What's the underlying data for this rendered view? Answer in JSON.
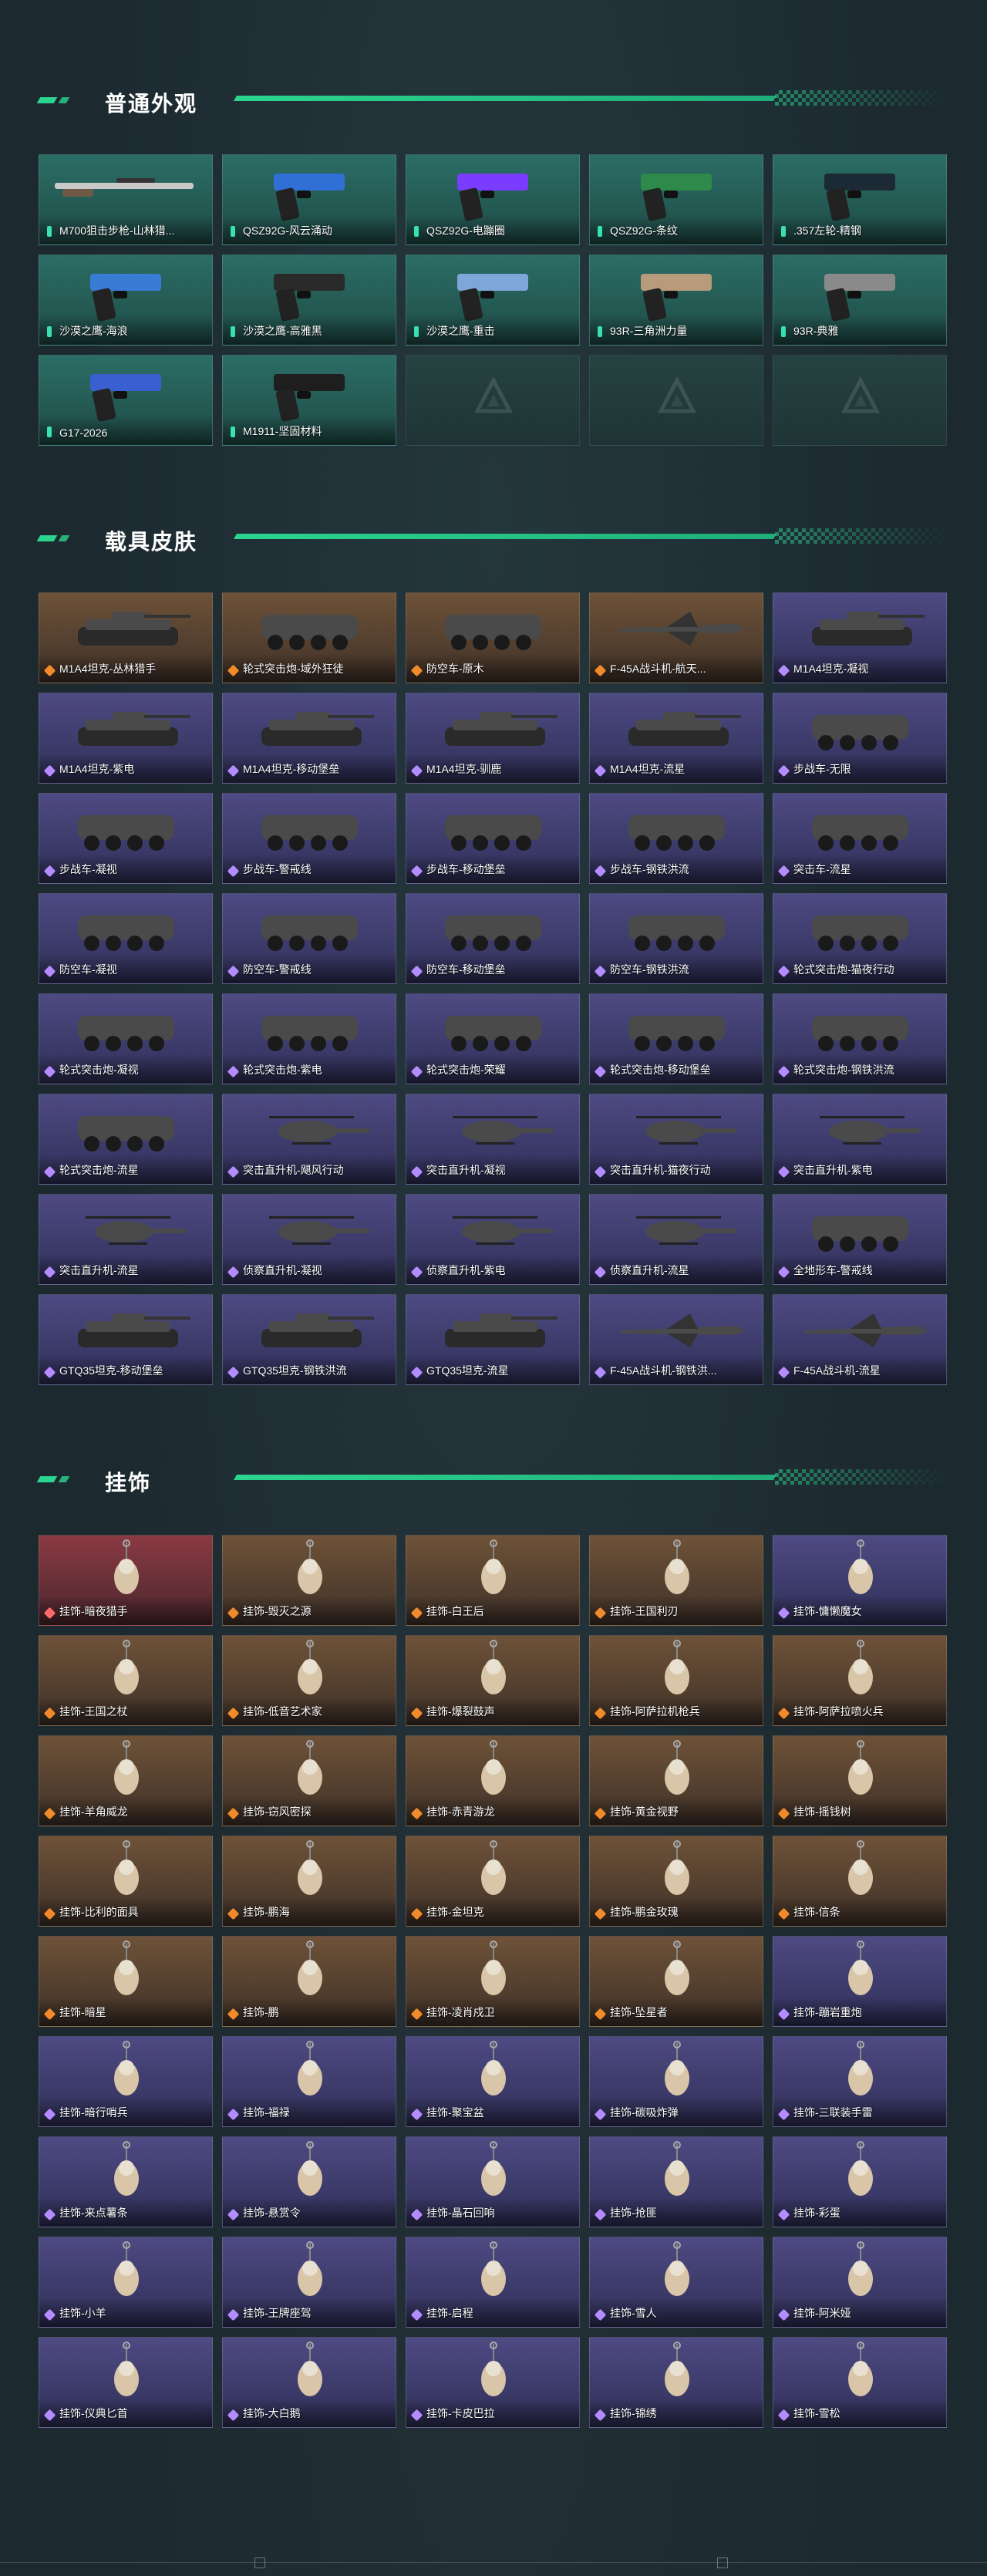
{
  "sections": {
    "weapons": {
      "title": "普通外观",
      "items": [
        {
          "label": "M700狙击步枪-山林猎...",
          "rarity": "green"
        },
        {
          "label": "QSZ92G-风云涌动",
          "rarity": "green"
        },
        {
          "label": "QSZ92G-电蹦圈",
          "rarity": "green"
        },
        {
          "label": "QSZ92G-条纹",
          "rarity": "green"
        },
        {
          "label": ".357左轮-精钢",
          "rarity": "green"
        },
        {
          "label": "沙漠之鹰-海浪",
          "rarity": "green"
        },
        {
          "label": "沙漠之鹰-高雅黑",
          "rarity": "green"
        },
        {
          "label": "沙漠之鹰-重击",
          "rarity": "green"
        },
        {
          "label": "93R-三角洲力量",
          "rarity": "green"
        },
        {
          "label": "93R-典雅",
          "rarity": "green"
        },
        {
          "label": "G17-2026",
          "rarity": "green"
        },
        {
          "label": "M1911-坚固材料",
          "rarity": "green"
        }
      ]
    },
    "vehicles": {
      "title": "载具皮肤",
      "items": [
        {
          "label": "M1A4坦克-丛林猎手",
          "rarity": "gold"
        },
        {
          "label": "轮式突击炮-域外狂徒",
          "rarity": "gold"
        },
        {
          "label": "防空车-原木",
          "rarity": "gold"
        },
        {
          "label": "F-45A战斗机-航天...",
          "rarity": "gold"
        },
        {
          "label": "M1A4坦克-凝视",
          "rarity": "purple"
        },
        {
          "label": "M1A4坦克-紫电",
          "rarity": "purple"
        },
        {
          "label": "M1A4坦克-移动堡垒",
          "rarity": "purple"
        },
        {
          "label": "M1A4坦克-驯鹿",
          "rarity": "purple"
        },
        {
          "label": "M1A4坦克-流星",
          "rarity": "purple"
        },
        {
          "label": "步战车-无限",
          "rarity": "purple"
        },
        {
          "label": "步战车-凝视",
          "rarity": "purple"
        },
        {
          "label": "步战车-警戒线",
          "rarity": "purple"
        },
        {
          "label": "步战车-移动堡垒",
          "rarity": "purple"
        },
        {
          "label": "步战车-钢铁洪流",
          "rarity": "purple"
        },
        {
          "label": "突击车-流星",
          "rarity": "purple"
        },
        {
          "label": "防空车-凝视",
          "rarity": "purple"
        },
        {
          "label": "防空车-警戒线",
          "rarity": "purple"
        },
        {
          "label": "防空车-移动堡垒",
          "rarity": "purple"
        },
        {
          "label": "防空车-钢铁洪流",
          "rarity": "purple"
        },
        {
          "label": "轮式突击炮-猫夜行动",
          "rarity": "purple"
        },
        {
          "label": "轮式突击炮-凝视",
          "rarity": "purple"
        },
        {
          "label": "轮式突击炮-紫电",
          "rarity": "purple"
        },
        {
          "label": "轮式突击炮-荣耀",
          "rarity": "purple"
        },
        {
          "label": "轮式突击炮-移动堡垒",
          "rarity": "purple"
        },
        {
          "label": "轮式突击炮-钢铁洪流",
          "rarity": "purple"
        },
        {
          "label": "轮式突击炮-流星",
          "rarity": "purple"
        },
        {
          "label": "突击直升机-飓风行动",
          "rarity": "purple"
        },
        {
          "label": "突击直升机-凝视",
          "rarity": "purple"
        },
        {
          "label": "突击直升机-猫夜行动",
          "rarity": "purple"
        },
        {
          "label": "突击直升机-紫电",
          "rarity": "purple"
        },
        {
          "label": "突击直升机-流星",
          "rarity": "purple"
        },
        {
          "label": "侦察直升机-凝视",
          "rarity": "purple"
        },
        {
          "label": "侦察直升机-紫电",
          "rarity": "purple"
        },
        {
          "label": "侦察直升机-流星",
          "rarity": "purple"
        },
        {
          "label": "全地形车-警戒线",
          "rarity": "purple"
        },
        {
          "label": "GTQ35坦克-移动堡垒",
          "rarity": "purple"
        },
        {
          "label": "GTQ35坦克-钢铁洪流",
          "rarity": "purple"
        },
        {
          "label": "GTQ35坦克-流星",
          "rarity": "purple"
        },
        {
          "label": "F-45A战斗机-钢铁洪...",
          "rarity": "purple"
        },
        {
          "label": "F-45A战斗机-流星",
          "rarity": "purple"
        }
      ]
    },
    "charms": {
      "title": "挂饰",
      "items": [
        {
          "label": "挂饰-暗夜猎手",
          "rarity": "red"
        },
        {
          "label": "挂饰-毁灭之源",
          "rarity": "gold"
        },
        {
          "label": "挂饰-白王后",
          "rarity": "gold"
        },
        {
          "label": "挂饰-王国利刃",
          "rarity": "gold"
        },
        {
          "label": "挂饰-慵懒魔女",
          "rarity": "purple"
        },
        {
          "label": "挂饰-王国之杖",
          "rarity": "gold"
        },
        {
          "label": "挂饰-低音艺术家",
          "rarity": "gold"
        },
        {
          "label": "挂饰-爆裂鼓声",
          "rarity": "gold"
        },
        {
          "label": "挂饰-阿萨拉机枪兵",
          "rarity": "gold"
        },
        {
          "label": "挂饰-阿萨拉喷火兵",
          "rarity": "gold"
        },
        {
          "label": "挂饰-羊角威龙",
          "rarity": "gold"
        },
        {
          "label": "挂饰-窃风密探",
          "rarity": "gold"
        },
        {
          "label": "挂饰-赤青游龙",
          "rarity": "gold"
        },
        {
          "label": "挂饰-黄金视野",
          "rarity": "gold"
        },
        {
          "label": "挂饰-摇钱树",
          "rarity": "gold"
        },
        {
          "label": "挂饰-比利的面具",
          "rarity": "gold"
        },
        {
          "label": "挂饰-鹏海",
          "rarity": "gold"
        },
        {
          "label": "挂饰-金坦克",
          "rarity": "gold"
        },
        {
          "label": "挂饰-鹏金玫瑰",
          "rarity": "gold"
        },
        {
          "label": "挂饰-信条",
          "rarity": "gold"
        },
        {
          "label": "挂饰-暗星",
          "rarity": "gold"
        },
        {
          "label": "挂饰-鹏",
          "rarity": "gold"
        },
        {
          "label": "挂饰-凌肖戍卫",
          "rarity": "gold"
        },
        {
          "label": "挂饰-坠星者",
          "rarity": "gold"
        },
        {
          "label": "挂饰-蹦岩重炮",
          "rarity": "purple"
        },
        {
          "label": "挂饰-暗行哨兵",
          "rarity": "purple"
        },
        {
          "label": "挂饰-福禄",
          "rarity": "purple"
        },
        {
          "label": "挂饰-聚宝盆",
          "rarity": "purple"
        },
        {
          "label": "挂饰-碳吸炸弹",
          "rarity": "purple"
        },
        {
          "label": "挂饰-三联装手雷",
          "rarity": "purple"
        },
        {
          "label": "挂饰-来点薯条",
          "rarity": "purple"
        },
        {
          "label": "挂饰-悬赏令",
          "rarity": "purple"
        },
        {
          "label": "挂饰-晶石回响",
          "rarity": "purple"
        },
        {
          "label": "挂饰-抢匪",
          "rarity": "purple"
        },
        {
          "label": "挂饰-彩蛋",
          "rarity": "purple"
        },
        {
          "label": "挂饰-小羊",
          "rarity": "purple"
        },
        {
          "label": "挂饰-王牌座驾",
          "rarity": "purple"
        },
        {
          "label": "挂饰-启程",
          "rarity": "purple"
        },
        {
          "label": "挂饰-雪人",
          "rarity": "purple"
        },
        {
          "label": "挂饰-阿米娅",
          "rarity": "purple"
        },
        {
          "label": "挂饰-仪典匕首",
          "rarity": "purple"
        },
        {
          "label": "挂饰-大白鹅",
          "rarity": "purple"
        },
        {
          "label": "挂饰-卡皮巴拉",
          "rarity": "purple"
        },
        {
          "label": "挂饰-锦绣",
          "rarity": "purple"
        },
        {
          "label": "挂饰-雪松",
          "rarity": "purple"
        }
      ]
    }
  },
  "colors": {
    "accent": "#2bd48f",
    "background": "#1c2a30",
    "green_card": "#2b6e66",
    "gold_card": "#6e5238",
    "purple_card": "#4e4a83",
    "red_card": "#8a3a43"
  },
  "icons": {
    "weapon": "pistol-icon",
    "vehicle": "vehicle-icon",
    "charm": "charm-icon",
    "empty": "delta-logo-icon"
  }
}
